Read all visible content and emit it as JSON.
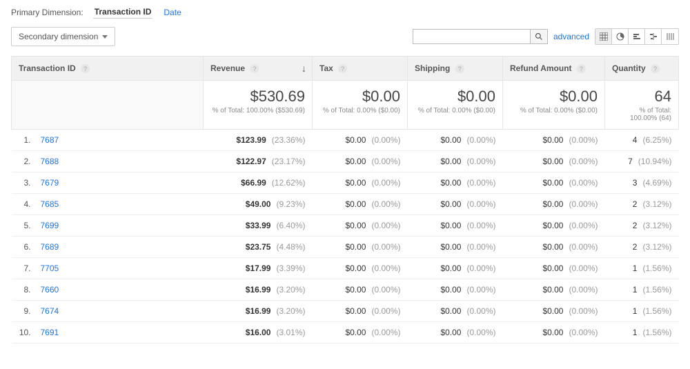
{
  "primary_dimension": {
    "label": "Primary Dimension:",
    "tabs": [
      {
        "label": "Transaction ID",
        "active": true
      },
      {
        "label": "Date",
        "active": false
      }
    ]
  },
  "toolbar": {
    "secondary_dimension_label": "Secondary dimension",
    "advanced_label": "advanced",
    "search_placeholder": ""
  },
  "columns": [
    {
      "key": "transaction_id",
      "label": "Transaction ID",
      "help": true,
      "sorted": false
    },
    {
      "key": "revenue",
      "label": "Revenue",
      "help": true,
      "sorted": "desc"
    },
    {
      "key": "tax",
      "label": "Tax",
      "help": true,
      "sorted": false
    },
    {
      "key": "shipping",
      "label": "Shipping",
      "help": true,
      "sorted": false
    },
    {
      "key": "refund",
      "label": "Refund Amount",
      "help": true,
      "sorted": false
    },
    {
      "key": "quantity",
      "label": "Quantity",
      "help": true,
      "sorted": false
    }
  ],
  "totals": {
    "revenue": {
      "value": "$530.69",
      "sub": "% of Total: 100.00% ($530.69)"
    },
    "tax": {
      "value": "$0.00",
      "sub": "% of Total: 0.00% ($0.00)"
    },
    "shipping": {
      "value": "$0.00",
      "sub": "% of Total: 0.00% ($0.00)"
    },
    "refund": {
      "value": "$0.00",
      "sub": "% of Total: 0.00% ($0.00)"
    },
    "quantity": {
      "value": "64",
      "sub": "% of Total: 100.00% (64)"
    }
  },
  "rows": [
    {
      "n": "1.",
      "id": "7687",
      "revenue": {
        "v": "$123.99",
        "p": "(23.36%)"
      },
      "tax": {
        "v": "$0.00",
        "p": "(0.00%)"
      },
      "shipping": {
        "v": "$0.00",
        "p": "(0.00%)"
      },
      "refund": {
        "v": "$0.00",
        "p": "(0.00%)"
      },
      "quantity": {
        "v": "4",
        "p": "(6.25%)"
      }
    },
    {
      "n": "2.",
      "id": "7688",
      "revenue": {
        "v": "$122.97",
        "p": "(23.17%)"
      },
      "tax": {
        "v": "$0.00",
        "p": "(0.00%)"
      },
      "shipping": {
        "v": "$0.00",
        "p": "(0.00%)"
      },
      "refund": {
        "v": "$0.00",
        "p": "(0.00%)"
      },
      "quantity": {
        "v": "7",
        "p": "(10.94%)"
      }
    },
    {
      "n": "3.",
      "id": "7679",
      "revenue": {
        "v": "$66.99",
        "p": "(12.62%)"
      },
      "tax": {
        "v": "$0.00",
        "p": "(0.00%)"
      },
      "shipping": {
        "v": "$0.00",
        "p": "(0.00%)"
      },
      "refund": {
        "v": "$0.00",
        "p": "(0.00%)"
      },
      "quantity": {
        "v": "3",
        "p": "(4.69%)"
      }
    },
    {
      "n": "4.",
      "id": "7685",
      "revenue": {
        "v": "$49.00",
        "p": "(9.23%)"
      },
      "tax": {
        "v": "$0.00",
        "p": "(0.00%)"
      },
      "shipping": {
        "v": "$0.00",
        "p": "(0.00%)"
      },
      "refund": {
        "v": "$0.00",
        "p": "(0.00%)"
      },
      "quantity": {
        "v": "2",
        "p": "(3.12%)"
      }
    },
    {
      "n": "5.",
      "id": "7699",
      "revenue": {
        "v": "$33.99",
        "p": "(6.40%)"
      },
      "tax": {
        "v": "$0.00",
        "p": "(0.00%)"
      },
      "shipping": {
        "v": "$0.00",
        "p": "(0.00%)"
      },
      "refund": {
        "v": "$0.00",
        "p": "(0.00%)"
      },
      "quantity": {
        "v": "2",
        "p": "(3.12%)"
      }
    },
    {
      "n": "6.",
      "id": "7689",
      "revenue": {
        "v": "$23.75",
        "p": "(4.48%)"
      },
      "tax": {
        "v": "$0.00",
        "p": "(0.00%)"
      },
      "shipping": {
        "v": "$0.00",
        "p": "(0.00%)"
      },
      "refund": {
        "v": "$0.00",
        "p": "(0.00%)"
      },
      "quantity": {
        "v": "2",
        "p": "(3.12%)"
      }
    },
    {
      "n": "7.",
      "id": "7705",
      "revenue": {
        "v": "$17.99",
        "p": "(3.39%)"
      },
      "tax": {
        "v": "$0.00",
        "p": "(0.00%)"
      },
      "shipping": {
        "v": "$0.00",
        "p": "(0.00%)"
      },
      "refund": {
        "v": "$0.00",
        "p": "(0.00%)"
      },
      "quantity": {
        "v": "1",
        "p": "(1.56%)"
      }
    },
    {
      "n": "8.",
      "id": "7660",
      "revenue": {
        "v": "$16.99",
        "p": "(3.20%)"
      },
      "tax": {
        "v": "$0.00",
        "p": "(0.00%)"
      },
      "shipping": {
        "v": "$0.00",
        "p": "(0.00%)"
      },
      "refund": {
        "v": "$0.00",
        "p": "(0.00%)"
      },
      "quantity": {
        "v": "1",
        "p": "(1.56%)"
      }
    },
    {
      "n": "9.",
      "id": "7674",
      "revenue": {
        "v": "$16.99",
        "p": "(3.20%)"
      },
      "tax": {
        "v": "$0.00",
        "p": "(0.00%)"
      },
      "shipping": {
        "v": "$0.00",
        "p": "(0.00%)"
      },
      "refund": {
        "v": "$0.00",
        "p": "(0.00%)"
      },
      "quantity": {
        "v": "1",
        "p": "(1.56%)"
      }
    },
    {
      "n": "10.",
      "id": "7691",
      "revenue": {
        "v": "$16.00",
        "p": "(3.01%)"
      },
      "tax": {
        "v": "$0.00",
        "p": "(0.00%)"
      },
      "shipping": {
        "v": "$0.00",
        "p": "(0.00%)"
      },
      "refund": {
        "v": "$0.00",
        "p": "(0.00%)"
      },
      "quantity": {
        "v": "1",
        "p": "(1.56%)"
      }
    }
  ]
}
